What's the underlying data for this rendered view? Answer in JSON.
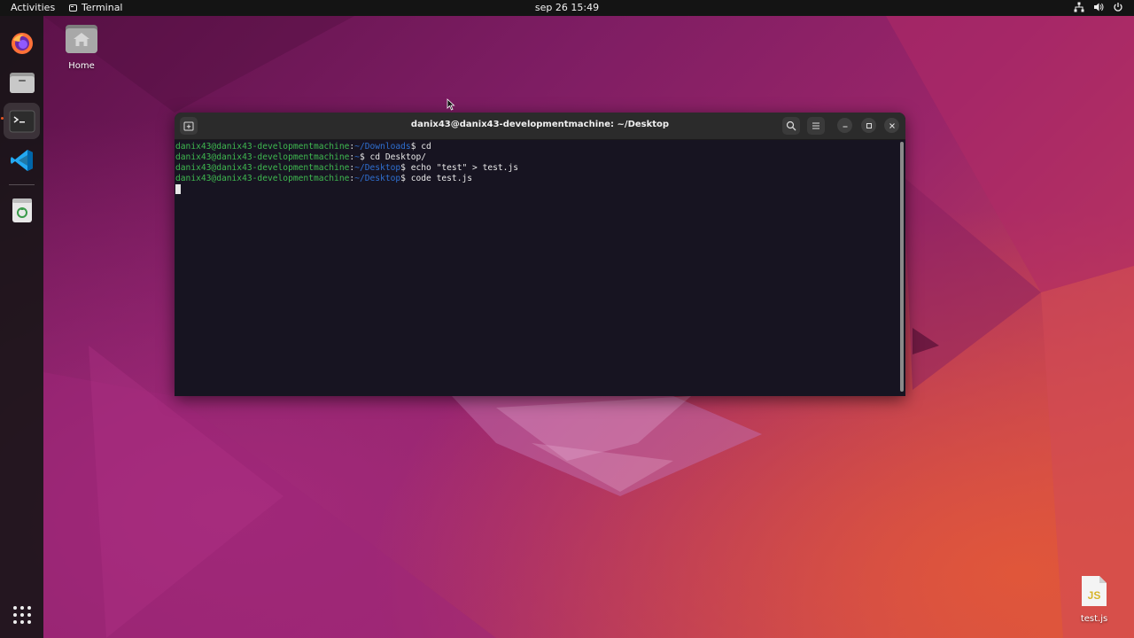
{
  "topbar": {
    "activities": "Activities",
    "app_name": "Terminal",
    "clock": "sep 26  15:49",
    "tray_icons": [
      "network-icon",
      "volume-icon",
      "power-icon"
    ]
  },
  "dock": {
    "apps": [
      {
        "name": "Firefox",
        "icon": "firefox-icon"
      },
      {
        "name": "Files",
        "icon": "files-icon"
      },
      {
        "name": "Terminal",
        "icon": "terminal-icon",
        "active": true
      },
      {
        "name": "Visual Studio Code",
        "icon": "vscode-icon"
      },
      {
        "name": "Trash",
        "icon": "trash-icon"
      }
    ],
    "show_apps_icon": "grid-icon"
  },
  "desktop": {
    "home_label": "Home",
    "file_label": "test.js",
    "file_badge": "JS"
  },
  "terminal": {
    "title": "danix43@danix43-developmentmachine: ~/Desktop",
    "lines": [
      {
        "user": "danix43@danix43-developmentmachine",
        "sep": ":",
        "path": "~/Downloads",
        "prompt": "$ ",
        "cmd": "cd"
      },
      {
        "user": "danix43@danix43-developmentmachine",
        "sep": ":",
        "path": "~",
        "prompt": "$ ",
        "cmd": "cd Desktop/"
      },
      {
        "user": "danix43@danix43-developmentmachine",
        "sep": ":",
        "path": "~/Desktop",
        "prompt": "$ ",
        "cmd": "echo \"test\" > test.js"
      },
      {
        "user": "danix43@danix43-developmentmachine",
        "sep": ":",
        "path": "~/Desktop",
        "prompt": "$ ",
        "cmd": "code test.js"
      }
    ]
  },
  "colors": {
    "accent": "#e95420",
    "terminal_bg": "#171421",
    "prompt_user": "#3fb950",
    "prompt_path": "#2f6fd0"
  }
}
